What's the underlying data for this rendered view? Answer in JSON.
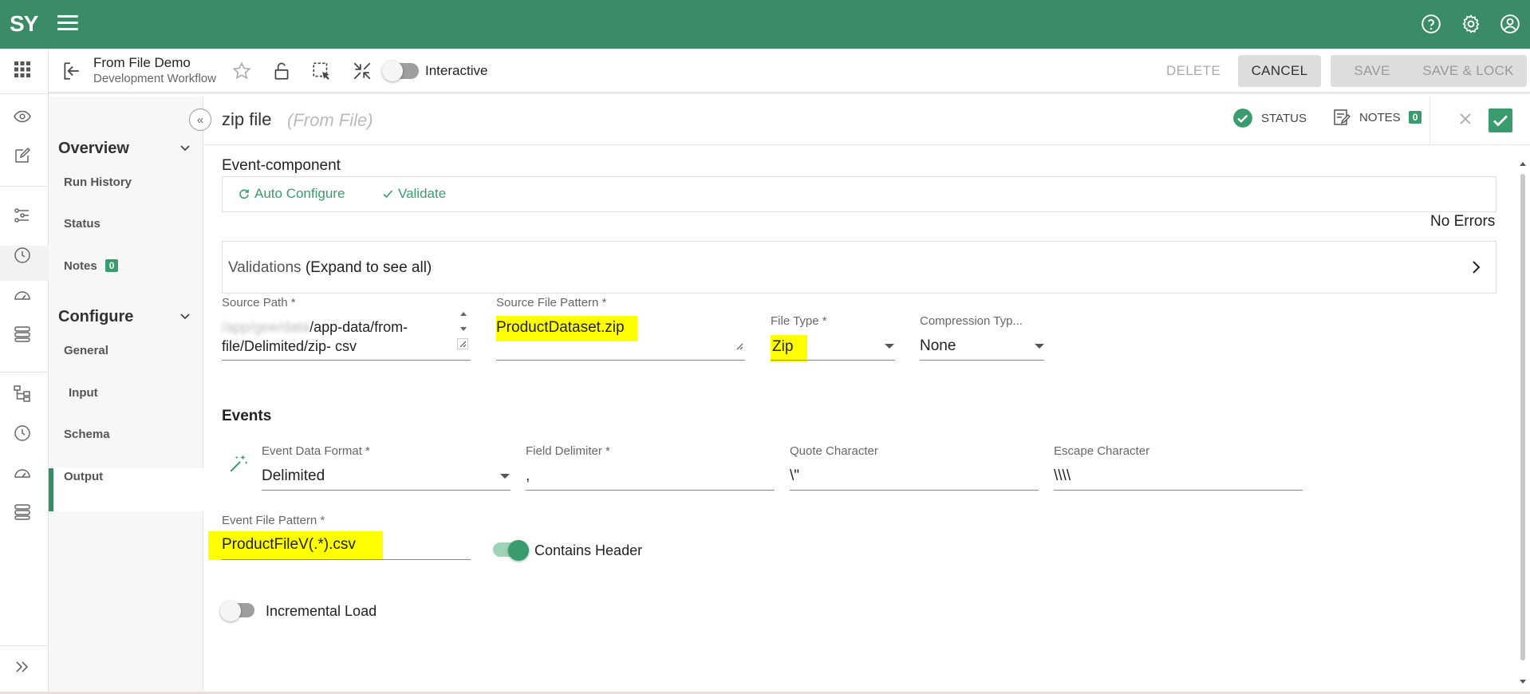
{
  "app": {
    "logo_text": "SY",
    "brand_color": "#3a8c68",
    "top_icons": [
      "help-icon",
      "settings-icon",
      "account-icon"
    ]
  },
  "toolbar": {
    "title": "From File Demo",
    "subtitle": "Development Workflow",
    "toggle_label": "Interactive",
    "delete_label": "DELETE",
    "cancel_label": "CANCEL",
    "save_label": "SAVE",
    "save_lock_label": "SAVE & LOCK"
  },
  "subnav": {
    "overview_title": "Overview",
    "overview_items": [
      "Run History",
      "Status",
      "Notes"
    ],
    "notes_count": "0",
    "configure_title": "Configure",
    "configure_items": [
      "General",
      "Input",
      "Schema",
      "Output"
    ],
    "active_item": "Input"
  },
  "header": {
    "title": "zip file",
    "subtitle": "(From File)",
    "status_label": "STATUS",
    "notes_label": "NOTES",
    "notes_count": "0"
  },
  "form": {
    "section_title": "Event-component",
    "auto_configure": "Auto Configure",
    "validate": "Validate",
    "errors_text": "No Errors",
    "validations_label": "Validations",
    "validations_hint": "(Expand to see all)",
    "source_path_label": "Source Path *",
    "source_path_blurred": "/app/gee/data",
    "source_path_line1": "/app-data/from-",
    "source_path_line2": "file/Delimited/zip- csv",
    "source_file_pattern_label": "Source File Pattern *",
    "source_file_pattern_value": "ProductDataset.zip",
    "file_type_label": "File Type *",
    "file_type_value": "Zip",
    "compression_label": "Compression Typ...",
    "compression_value": "None",
    "events_title": "Events",
    "event_data_format_label": "Event Data Format *",
    "event_data_format_value": "Delimited",
    "field_delimiter_label": "Field Delimiter *",
    "field_delimiter_value": ",",
    "quote_char_label": "Quote Character",
    "quote_char_value": "\\\"",
    "escape_char_label": "Escape Character",
    "escape_char_value": "\\\\\\\\",
    "event_file_pattern_label": "Event File Pattern *",
    "event_file_pattern_value": "ProductFileV(.*).csv",
    "contains_header_label": "Contains Header",
    "contains_header_on": true,
    "incremental_load_label": "Incremental Load",
    "incremental_load_on": false,
    "highlight_color": "#ffff00"
  }
}
